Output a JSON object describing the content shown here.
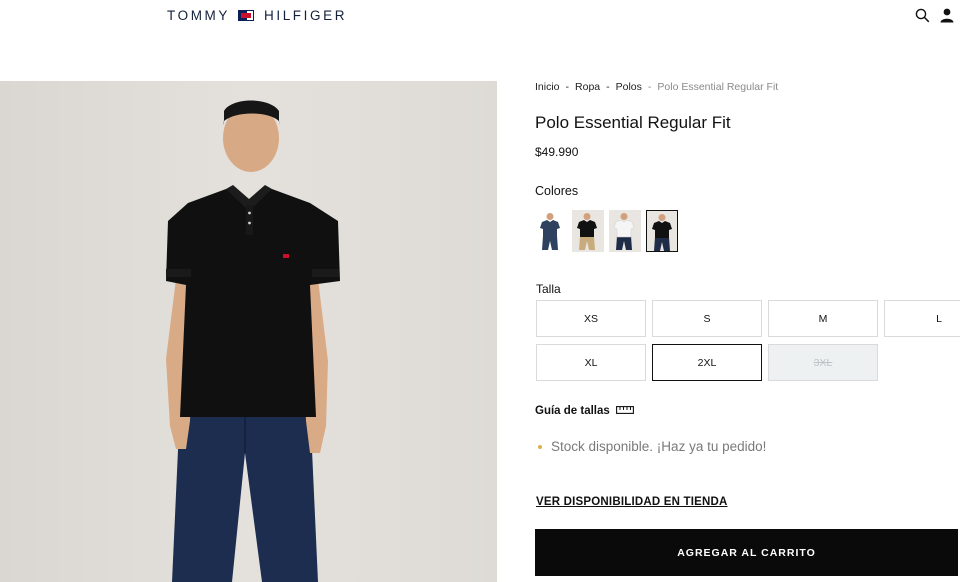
{
  "brand": {
    "left": "TOMMY",
    "right": "HILFIGER"
  },
  "breadcrumb": [
    "Inicio",
    "Ropa",
    "Polos",
    "Polo Essential Regular Fit"
  ],
  "breadcrumb_separator": "-",
  "product": {
    "title": "Polo Essential Regular Fit",
    "price": "$49.990"
  },
  "colors": {
    "label": "Colores",
    "swatches": [
      {
        "name": "navy polo",
        "shirt": "#2e4260",
        "pants": "#2e4260"
      },
      {
        "name": "black polo with khaki",
        "shirt": "#111111",
        "pants": "#c9ac7e"
      },
      {
        "name": "white polo",
        "shirt": "#f5f5f5",
        "pants": "#1f2c48"
      },
      {
        "name": "black polo",
        "shirt": "#111111",
        "pants": "#1f2c48",
        "selected": true
      }
    ]
  },
  "sizes": {
    "label": "Talla",
    "options": [
      {
        "label": "XS"
      },
      {
        "label": "S"
      },
      {
        "label": "M"
      },
      {
        "label": "L"
      },
      {
        "label": "XL"
      },
      {
        "label": "2XL",
        "selected": true
      },
      {
        "label": "3XL",
        "disabled": true
      }
    ]
  },
  "size_guide": "Guía de tallas",
  "stock_message": "Stock disponible. ¡Haz ya tu pedido!",
  "store_availability_link": "VER DISPONIBILIDAD EN TIENDA",
  "add_to_cart": "AGREGAR AL CARRITO",
  "icons": [
    "search-icon",
    "user-icon",
    "ruler-icon"
  ],
  "colors_palette": {
    "navy": "#14213d",
    "red": "#c8102e",
    "black": "#0a0a0a",
    "stock_dot": "#d9b24a"
  }
}
